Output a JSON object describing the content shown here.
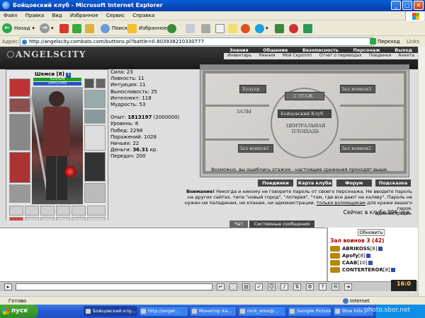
{
  "window": {
    "title": "Бойцовский клуб - Microsoft Internet Explorer"
  },
  "menu": [
    "Файл",
    "Правка",
    "Вид",
    "Избранное",
    "Сервис",
    "Справка"
  ],
  "toolbar": {
    "back_label": "Назад",
    "search_label": "Поиск",
    "favorites_label": "Избранное"
  },
  "address": {
    "label": "Адрес:",
    "url": "http://angelscity.combats.com/buttons.pl?battle=0.803938210330777",
    "go_label": "Переход",
    "links_label": "Links"
  },
  "site": {
    "logo": "ANGELSCITY",
    "nav_top": [
      "Знания",
      "Общение",
      "Безопасность",
      "Персонаж",
      "Выход"
    ],
    "nav_bottom": [
      "Инвентарь",
      "Умения",
      "Мой Скроллп",
      "Отчет о переводах",
      "Поединки",
      "Анкета"
    ]
  },
  "character": {
    "name": "Шемси [8]",
    "hp": "515/628",
    "mana": "1445/1445",
    "stats": {
      "strength": "Сила: 23",
      "agility": "Ловкость: 11",
      "intuition": "Интуиция: 11",
      "endurance": "Выносливость: 25",
      "intellect": "Интеллект: 118",
      "wisdom": "Мудрость: 53"
    },
    "exp_label": "Опыт:",
    "exp_value": "1813197",
    "exp_next": "(2000000)",
    "level": "Уровень: 8",
    "wins": "Побед: 2298",
    "losses": "Поражений: 1028",
    "draws": "Ничьих: 22",
    "money_label": "Деньги:",
    "money_value": "36.31",
    "money_unit": "кр.",
    "transfers": "Передач: 200"
  },
  "map": {
    "rooms": {
      "boudoir": "Будуар",
      "floor2": "2 ЭТАЖ",
      "hall3": "Зал воинов3",
      "halls": "ЗАЛЫ",
      "fight_club": "Бойцовский Клуб",
      "central_square_1": "ЦЕНТРАЛЬНАЯ",
      "central_square_2": "ПЛОЩАДЬ",
      "hall1": "Зал воинов1",
      "hall2": "Зал воинов2"
    },
    "message": "Возможно, вы ошиблись этажом - настоящие сражения проходят выше."
  },
  "buttons": [
    "Поединки",
    "Карта клуба",
    "Форум",
    "Подсказка"
  ],
  "warning": {
    "bold": "Внимание!",
    "text1": " Никогда и никому не говорите пароль от своего персонажа. Не вводите пароль на других сайтах, типа \"новый город\", \"лотерея\", \"там, где все дают на халяву\". Пароль не нужен ни паладинам, ни кланам, ни администрации, ",
    "underline": "только взломщикам",
    "text2": " для кражи вашего героя.",
    "signature": "Администрация."
  },
  "online": "Сейчас в клубе 996 чел.",
  "chat": {
    "tabs": [
      "Чат",
      "Системные сообщения"
    ],
    "refresh_label": "Обновить",
    "room_title": "Зал воинов 3 (42)",
    "users": [
      {
        "name": "ABRIKOSS",
        "level": "[8]"
      },
      {
        "name": "Apofy",
        "level": "[8]"
      },
      {
        "name": "CAAB",
        "level": "[10]"
      },
      {
        "name": "CONTERTEROR",
        "level": "[8]"
      }
    ],
    "clock": "16:0"
  },
  "status": {
    "text": "Готово",
    "zone": "Internet"
  },
  "taskbar": {
    "start": "пуск",
    "tasks": [
      "Бойцовский клу...",
      "http://angel...",
      "Монитор Ха...",
      "rock_emo@...",
      "Sample Pictures",
      "Blue hills"
    ]
  },
  "watermark": "photo.sbor.net",
  "colors": {
    "titlebar": "#0846b8",
    "hp": "#1e9e1e",
    "mana": "#2453c8",
    "room_title": "#aa0000",
    "start": "#2d8a24"
  }
}
